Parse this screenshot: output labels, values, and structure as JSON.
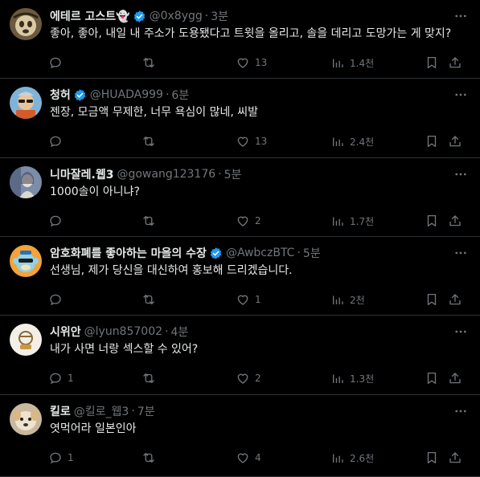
{
  "colors": {
    "background": "#000000",
    "text": "#e7e9ea",
    "muted": "#71767b",
    "verified": "#1d9bf0",
    "divider": "#2f3336"
  },
  "replies": [
    {
      "name": "에테르 고스트👻",
      "verified": true,
      "handle": "@0x8ygg",
      "time": "3분",
      "text": "좋아, 좋아, 내일 내 주소가 도용됐다고 트윗을 올리고, 솔을 데리고 도망가는 게 맞지?",
      "replies_count": "",
      "retweets_count": "",
      "likes": "13",
      "views": "1.4천",
      "avatar_icon": "avatar-ghost"
    },
    {
      "name": "청허",
      "verified": true,
      "handle": "@HUADA999",
      "time": "6분",
      "text": "젠장, 모금액 무제한, 너무 욕심이 많네, 씨발",
      "replies_count": "",
      "retweets_count": "",
      "likes": "13",
      "views": "2.4천",
      "avatar_icon": "avatar-sunglasses"
    },
    {
      "name": "니마잘레.웹3",
      "verified": false,
      "handle": "@gowang123176",
      "time": "5분",
      "text": "1000솔이 아니냐?",
      "replies_count": "",
      "retweets_count": "",
      "likes": "2",
      "views": "1.7천",
      "avatar_icon": "avatar-portrait"
    },
    {
      "name": "암호화폐를 좋아하는 마을의 수장",
      "verified": true,
      "handle": "@AwbczBTC",
      "time": "5분",
      "text": "선생님, 제가 당신을 대신하여 홍보해 드리겠습니다.",
      "replies_count": "",
      "retweets_count": "",
      "likes": "1",
      "views": "2천",
      "avatar_icon": "avatar-cartoon-monkey"
    },
    {
      "name": "시위안",
      "verified": false,
      "handle": "@lyun857002",
      "time": "4분",
      "text": "내가 사면 너랑 섹스할 수 있어?",
      "replies_count": "1",
      "retweets_count": "",
      "likes": "2",
      "views": "1.3천",
      "avatar_icon": "avatar-drawing"
    },
    {
      "name": "킬로",
      "verified": false,
      "handle": "@킬로_웹3",
      "time": "7분",
      "text": "엿먹어라 일본인아",
      "replies_count": "1",
      "retweets_count": "",
      "likes": "4",
      "views": "2.6천",
      "avatar_icon": "avatar-puppy"
    }
  ],
  "icons": {
    "reply": "comment-icon",
    "retweet": "retweet-icon",
    "like": "heart-icon",
    "views": "views-bar-chart-icon",
    "bookmark": "bookmark-icon",
    "share": "share-icon",
    "more": "more-dots-icon",
    "verified": "verified-badge-icon"
  }
}
